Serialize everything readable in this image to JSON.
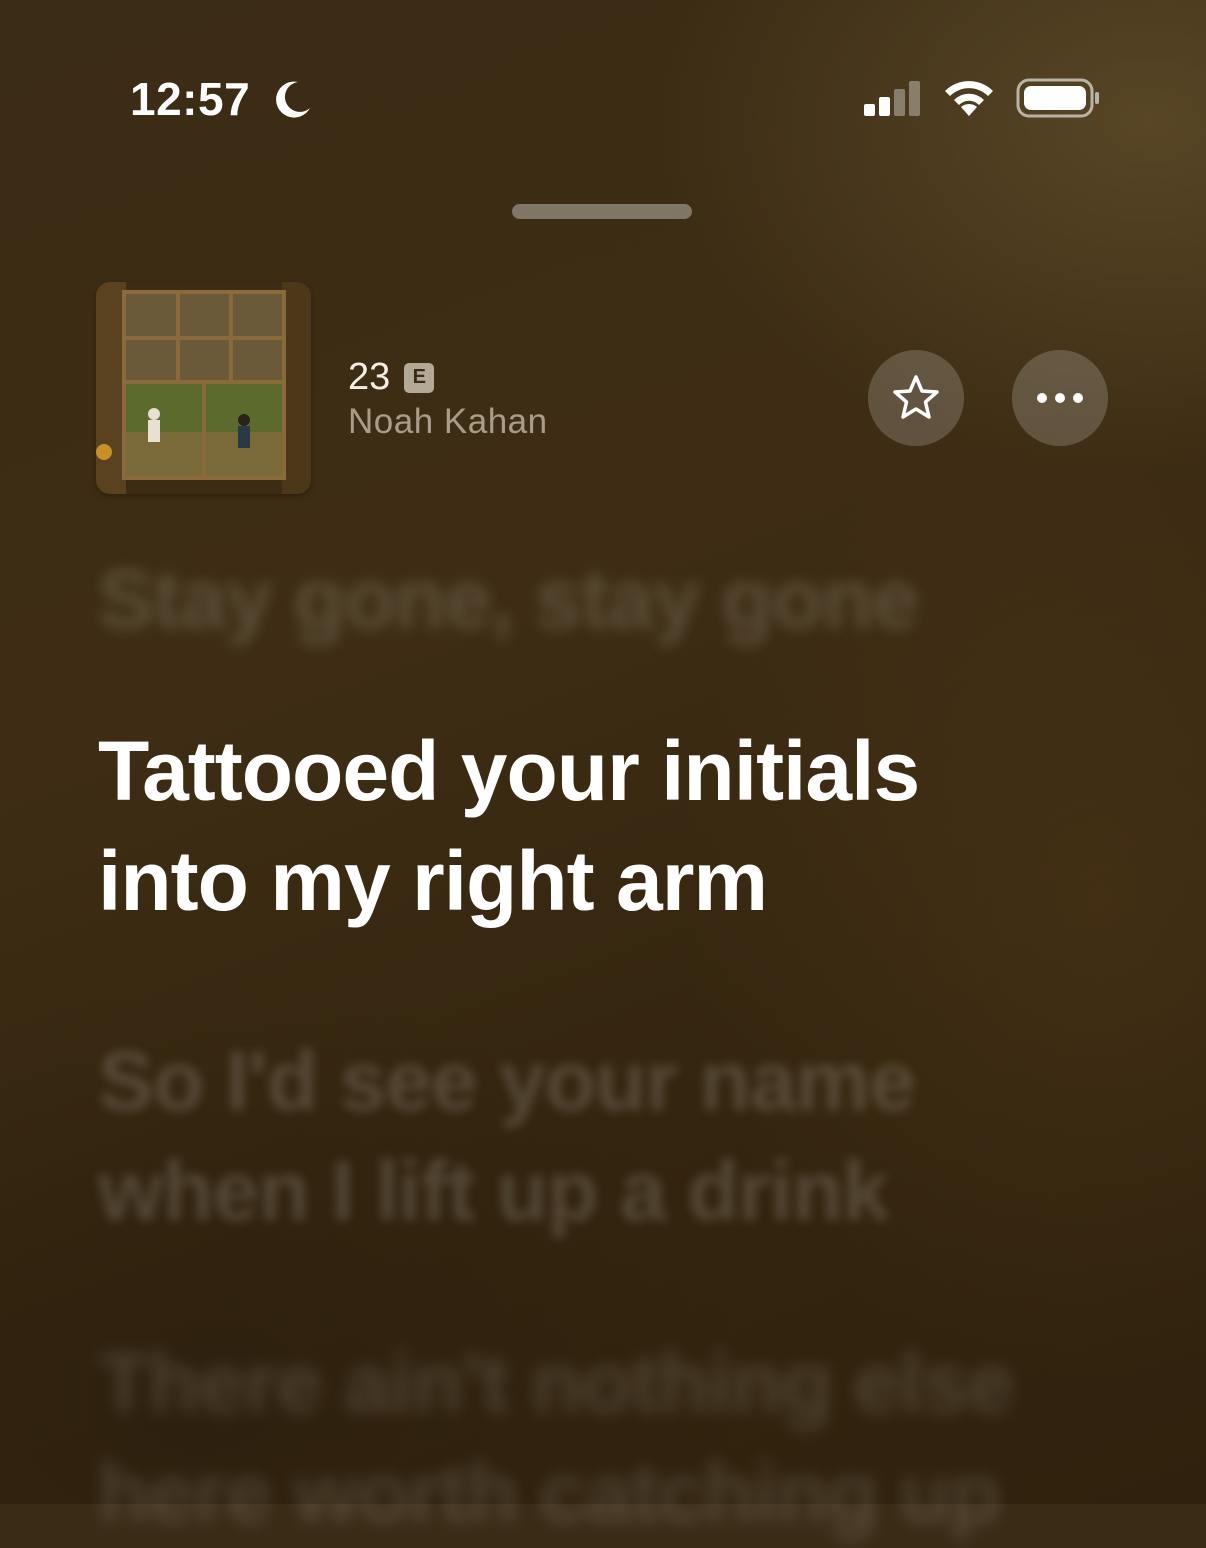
{
  "status_bar": {
    "time": "12:57",
    "focus_icon": "moon-icon",
    "signal_icon": "cellular-signal-icon",
    "wifi_icon": "wifi-icon",
    "battery_icon": "battery-icon"
  },
  "now_playing": {
    "title": "23",
    "explicit_badge": "E",
    "artist": "Noah Kahan",
    "artwork_icon": "album-artwork",
    "favorite_icon": "star-icon",
    "more_icon": "ellipsis-icon"
  },
  "lyrics": {
    "previous": [
      "Stay gone, stay gone"
    ],
    "current": [
      "Tattooed your initials",
      "into my right arm"
    ],
    "next": [
      "So I'd see your name",
      "when I lift up a drink"
    ],
    "next2": [
      "There ain't nothing else",
      "here worth catching up"
    ]
  },
  "colors": {
    "background": "#3a2b16",
    "active_lyric": "#ffffff"
  }
}
